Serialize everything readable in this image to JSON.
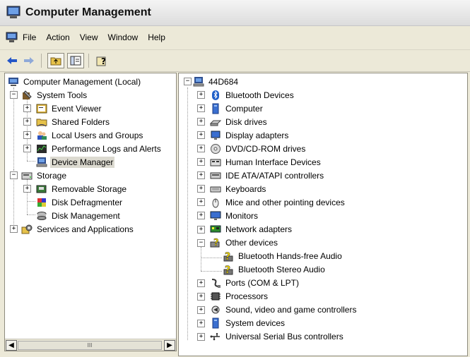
{
  "window": {
    "title": "Computer Management"
  },
  "menu": [
    "File",
    "Action",
    "View",
    "Window",
    "Help"
  ],
  "toolbar": [
    "back-arrow",
    "forward-arrow",
    "up-folder",
    "show-hide-tree",
    "help"
  ],
  "left_tree": {
    "root": "Computer Management (Local)",
    "system_tools": "System Tools",
    "event_viewer": "Event Viewer",
    "shared_folders": "Shared Folders",
    "local_users": "Local Users and Groups",
    "perf_logs": "Performance Logs and Alerts",
    "device_manager": "Device Manager",
    "storage": "Storage",
    "removable_storage": "Removable Storage",
    "disk_defrag": "Disk Defragmenter",
    "disk_mgmt": "Disk Management",
    "services": "Services and Applications",
    "scroll_grip": "III"
  },
  "right_tree": {
    "computer": "44D684",
    "items": [
      "Bluetooth Devices",
      "Computer",
      "Disk drives",
      "Display adapters",
      "DVD/CD-ROM drives",
      "Human Interface Devices",
      "IDE ATA/ATAPI controllers",
      "Keyboards",
      "Mice and other pointing devices",
      "Monitors",
      "Network adapters",
      "Other devices",
      "Bluetooth Hands-free Audio",
      "Bluetooth Stereo Audio",
      "Ports (COM & LPT)",
      "Processors",
      "Sound, video and game controllers",
      "System devices",
      "Universal Serial Bus controllers"
    ]
  }
}
